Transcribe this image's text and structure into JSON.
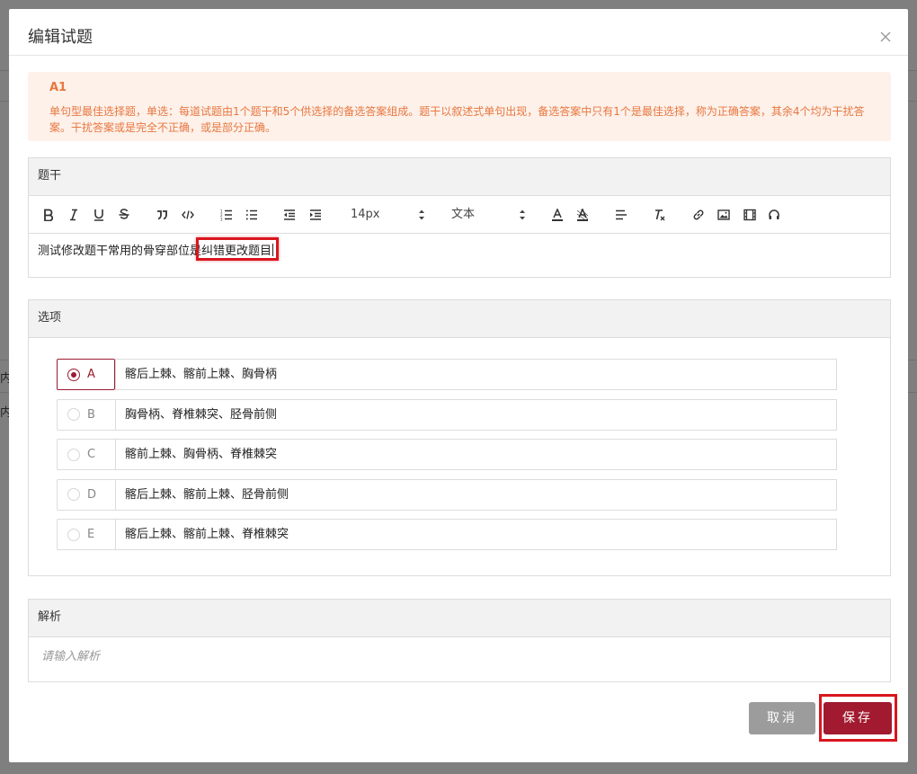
{
  "modal": {
    "title": "编辑试题",
    "close_icon": "close-icon"
  },
  "notice": {
    "code": "A1",
    "description": "单句型最佳选择题，单选：每道试题由1个题干和5个供选择的备选答案组成。题干以叙述式单句出现，备选答案中只有1个是最佳选择，称为正确答案，其余4个均为干扰答案。干扰答案或是完全不正确，或是部分正确。"
  },
  "stem": {
    "label": "题干",
    "text_before": "测试修改题干常用的骨穿部位是",
    "text_highlight": "纠错更改题目",
    "toolbar": {
      "font_size": "14px",
      "block_type": "文本",
      "icons": [
        "bold-icon",
        "italic-icon",
        "underline-icon",
        "strikethrough-icon",
        "blockquote-icon",
        "code-icon",
        "ordered-list-icon",
        "bullet-list-icon",
        "outdent-icon",
        "indent-icon",
        "font-color-icon",
        "background-color-icon",
        "align-icon",
        "clear-format-icon",
        "link-icon",
        "image-icon",
        "video-icon",
        "audio-icon"
      ]
    }
  },
  "options": {
    "label": "选项",
    "items": [
      {
        "letter": "A",
        "text": "髂后上棘、髂前上棘、胸骨柄",
        "selected": true
      },
      {
        "letter": "B",
        "text": "胸骨柄、脊椎棘突、胫骨前侧",
        "selected": false
      },
      {
        "letter": "C",
        "text": "髂前上棘、胸骨柄、脊椎棘突",
        "selected": false
      },
      {
        "letter": "D",
        "text": "髂后上棘、髂前上棘、胫骨前侧",
        "selected": false
      },
      {
        "letter": "E",
        "text": "髂后上棘、髂前上棘、脊椎棘突",
        "selected": false
      }
    ]
  },
  "analysis": {
    "label": "解析",
    "placeholder": "请输入解析"
  },
  "buttons": {
    "cancel": "取消",
    "save": "保存"
  },
  "background": {
    "fragment_1": "内",
    "fragment_2": "内"
  },
  "colors": {
    "brand": "#a11a2f",
    "notice_text": "#e8773f",
    "notice_bg": "#fdf1ea",
    "highlight": "#d9161e"
  }
}
